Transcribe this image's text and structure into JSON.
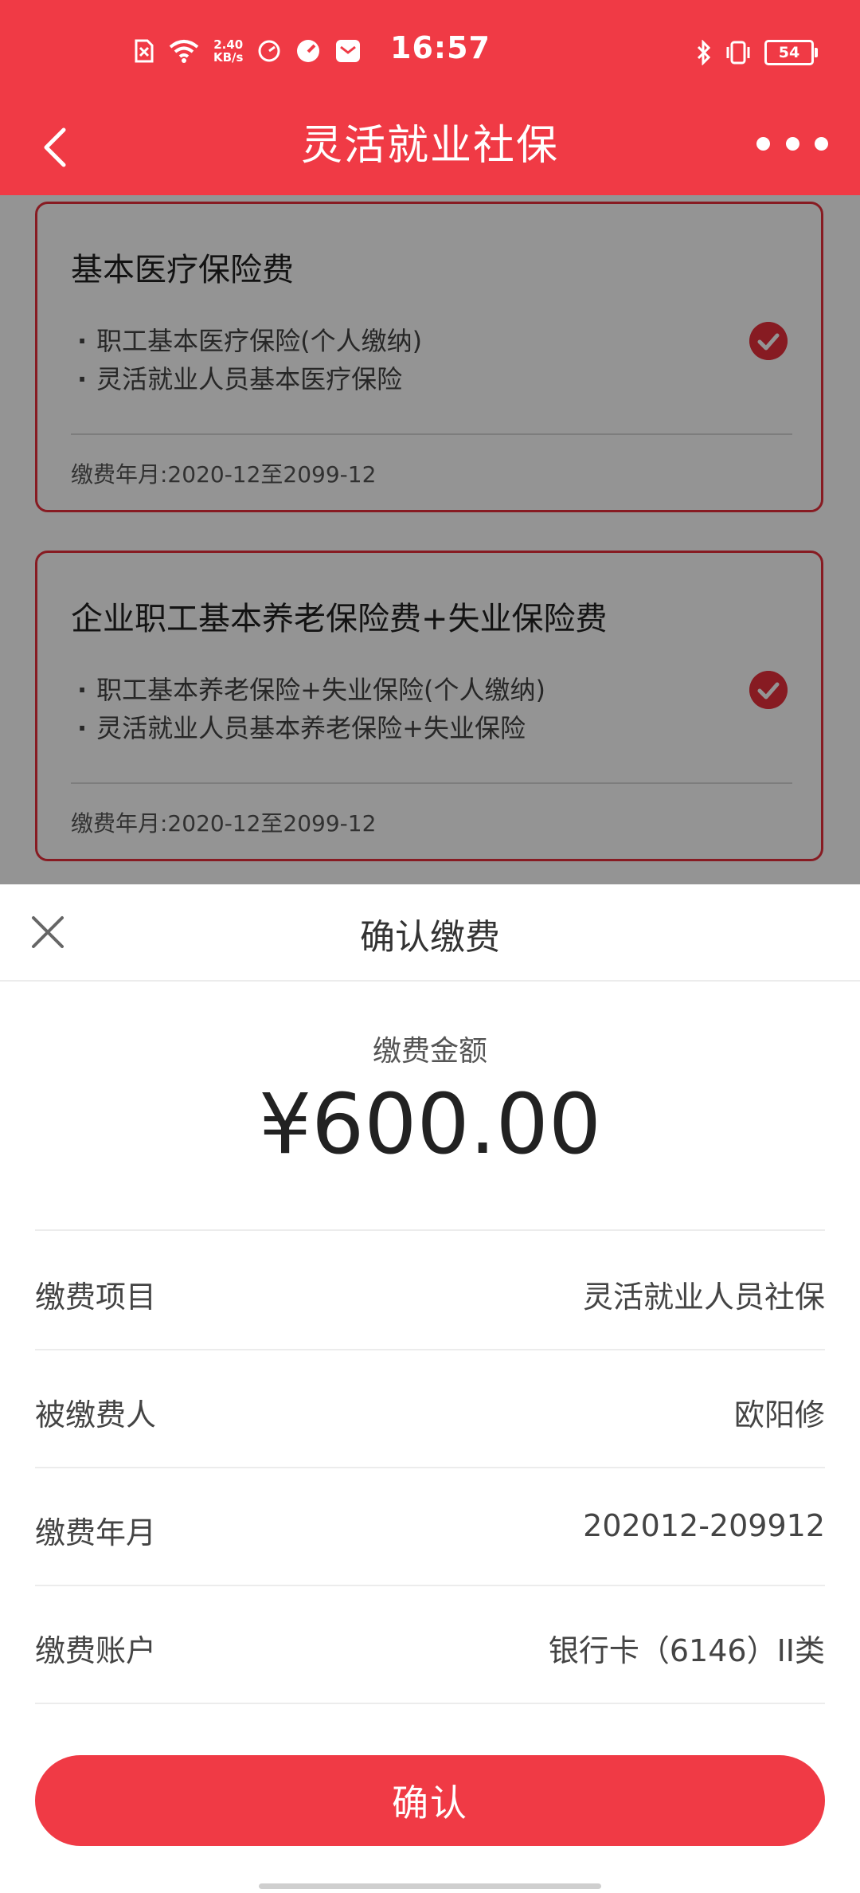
{
  "status_bar": {
    "net_speed_value": "2.40",
    "net_speed_unit": "KB/s",
    "time": "16:57",
    "battery": "54",
    "icons": [
      "sim-error-icon",
      "wifi-icon",
      "timer-icon",
      "speedometer-icon",
      "mail-icon",
      "bluetooth-icon",
      "vibrate-icon",
      "battery-icon"
    ]
  },
  "nav": {
    "title": "灵活就业社保",
    "back_icon": "chevron-left-icon",
    "more_icon": "more-dots-icon"
  },
  "cards": [
    {
      "title": "基本医疗保险费",
      "items": [
        "职工基本医疗保险(个人缴纳)",
        "灵活就业人员基本医疗保险"
      ],
      "period": "缴费年月:2020-12至2099-12",
      "selected": true
    },
    {
      "title": "企业职工基本养老保险费+失业保险费",
      "items": [
        "职工基本养老保险+失业保险(个人缴纳)",
        "灵活就业人员基本养老保险+失业保险"
      ],
      "period": "缴费年月:2020-12至2099-12",
      "selected": true
    }
  ],
  "sheet": {
    "title": "确认缴费",
    "amount_label": "缴费金额",
    "amount_value": "¥600.00",
    "rows": [
      {
        "label": "缴费项目",
        "value": "灵活就业人员社保"
      },
      {
        "label": "被缴费人",
        "value": "欧阳修"
      },
      {
        "label": "缴费年月",
        "value": "202012-209912"
      },
      {
        "label": "缴费账户",
        "value": "银行卡（6146）II类"
      }
    ],
    "confirm_label": "确认"
  },
  "colors": {
    "brand_red": "#f03a45",
    "card_border": "#e8303c"
  }
}
